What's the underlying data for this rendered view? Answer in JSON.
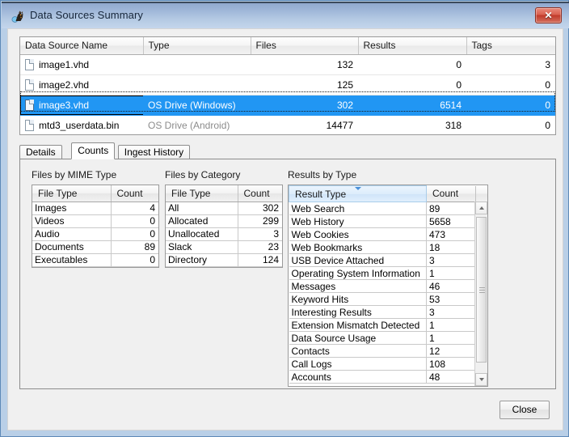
{
  "window": {
    "title": "Data Sources Summary",
    "icon": "autopsy-logo-icon",
    "close_button_glyph": "✕"
  },
  "data_sources_table": {
    "columns": [
      "Data Source Name",
      "Type",
      "Files",
      "Results",
      "Tags"
    ],
    "rows": [
      {
        "name": "image1.vhd",
        "type": "",
        "files": "132",
        "results": "0",
        "tags": "3",
        "selected": false
      },
      {
        "name": "image2.vhd",
        "type": "",
        "files": "125",
        "results": "0",
        "tags": "0",
        "selected": false
      },
      {
        "name": "image3.vhd",
        "type": "OS Drive (Windows)",
        "files": "302",
        "results": "6514",
        "tags": "0",
        "selected": true
      },
      {
        "name": "mtd3_userdata.bin",
        "type": "OS Drive (Android)",
        "files": "14477",
        "results": "318",
        "tags": "0",
        "selected": false
      }
    ]
  },
  "tabs": [
    {
      "label": "Details",
      "active": false
    },
    {
      "label": "Counts",
      "active": true
    },
    {
      "label": "Ingest History",
      "active": false
    }
  ],
  "counts_tab": {
    "mime_section": {
      "title": "Files by MIME Type",
      "columns": [
        "File Type",
        "Count"
      ],
      "rows": [
        {
          "type": "Images",
          "count": "4"
        },
        {
          "type": "Videos",
          "count": "0"
        },
        {
          "type": "Audio",
          "count": "0"
        },
        {
          "type": "Documents",
          "count": "89"
        },
        {
          "type": "Executables",
          "count": "0"
        }
      ]
    },
    "category_section": {
      "title": "Files by Category",
      "columns": [
        "File Type",
        "Count"
      ],
      "rows": [
        {
          "type": "All",
          "count": "302"
        },
        {
          "type": "Allocated",
          "count": "299"
        },
        {
          "type": "Unallocated",
          "count": "3"
        },
        {
          "type": "Slack",
          "count": "23"
        },
        {
          "type": "Directory",
          "count": "124"
        }
      ]
    },
    "results_section": {
      "title": "Results by Type",
      "columns": [
        "Result Type",
        "Count"
      ],
      "sorted_column": "Result Type",
      "sort_direction": "descending",
      "rows": [
        {
          "type": "Web Search",
          "count": "89"
        },
        {
          "type": "Web History",
          "count": "5658"
        },
        {
          "type": "Web Cookies",
          "count": "473"
        },
        {
          "type": "Web Bookmarks",
          "count": "18"
        },
        {
          "type": "USB Device Attached",
          "count": "3"
        },
        {
          "type": "Operating System Information",
          "count": "1"
        },
        {
          "type": "Messages",
          "count": "46"
        },
        {
          "type": "Keyword Hits",
          "count": "53"
        },
        {
          "type": "Interesting Results",
          "count": "3"
        },
        {
          "type": "Extension Mismatch Detected",
          "count": "1"
        },
        {
          "type": "Data Source Usage",
          "count": "1"
        },
        {
          "type": "Contacts",
          "count": "12"
        },
        {
          "type": "Call Logs",
          "count": "108"
        },
        {
          "type": "Accounts",
          "count": "48"
        }
      ]
    }
  },
  "footer": {
    "close_label": "Close"
  },
  "colors": {
    "selection": "#2196f3",
    "title_bar": "#a8c0e0",
    "close_button": "#c03a2a",
    "sort_arrow": "#4a90d9"
  }
}
